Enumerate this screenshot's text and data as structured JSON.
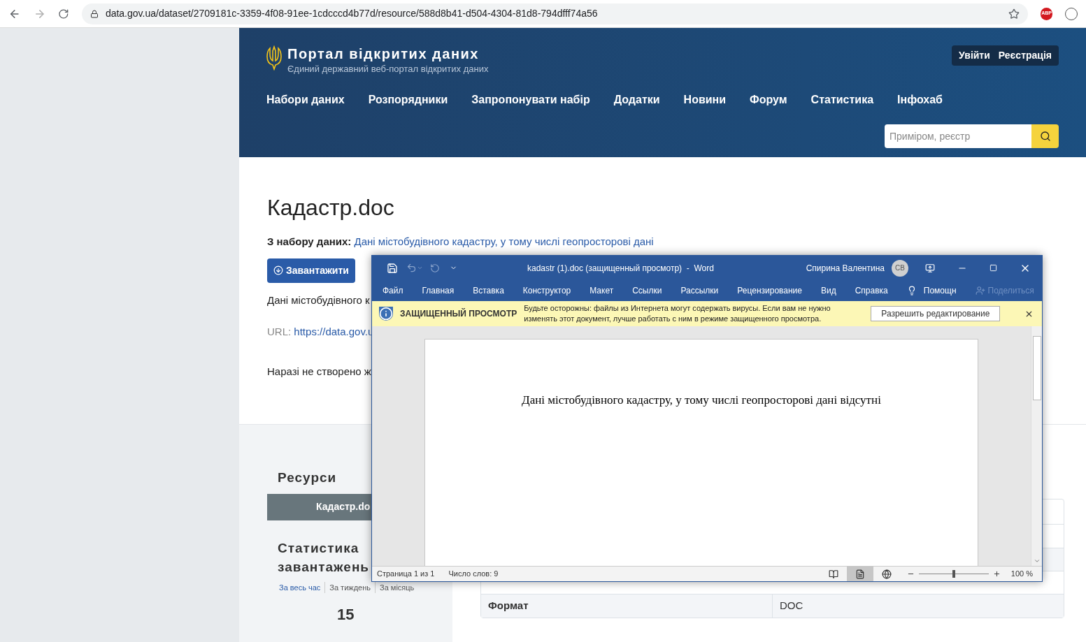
{
  "browser": {
    "url": "data.gov.ua/dataset/2709181c-3359-4f08-91ee-1cdcccd4b77d/resource/588d8b41-d504-4304-81d8-794dfff74a56",
    "extension_badge": "ABP"
  },
  "header": {
    "title": "Портал відкритих даних",
    "subtitle": "Єдиний державний веб-портал відкритих даних",
    "auth": [
      "Увійти",
      "Реєстрація"
    ],
    "nav": [
      "Набори даних",
      "Розпорядники",
      "Запропонувати набір",
      "Додатки",
      "Новини",
      "Форум",
      "Статистика",
      "Інфохаб"
    ],
    "search": {
      "placeholder": "Приміром, реєстр"
    }
  },
  "resource": {
    "title": "Кадастр.doc",
    "dataset_label": "З набору даних:",
    "dataset_link": "Дані містобудівного кадастру, у тому числі геопросторові дані",
    "download": "Завантажити",
    "description": "Дані містобудівного к",
    "url_label": "URL:",
    "url": "https://data.gov.u",
    "note": "Наразі не створено ж"
  },
  "sidebar": {
    "resources_title": "Ресурси",
    "resources": [
      {
        "label": "Кадастр.do",
        "selected": true
      }
    ],
    "stats_title": "Статистика завантажень",
    "stats_tabs": [
      {
        "label": "За весь час",
        "selected": true
      },
      {
        "label": "За тиждень",
        "selected": false
      },
      {
        "label": "За місяць",
        "selected": false
      }
    ],
    "count": "15"
  },
  "table": {
    "rows": [
      {
        "label": "Формат",
        "value": "DOC"
      }
    ]
  },
  "word": {
    "title": "kadastr (1).doc (защищенный просмотр)  -  Word",
    "user": "Спирина Валентина",
    "avatar": "СВ",
    "menu": [
      {
        "label": "Файл",
        "kind": "tab"
      },
      {
        "label": "Главная",
        "kind": "tab"
      },
      {
        "label": "Вставка",
        "kind": "tab"
      },
      {
        "label": "Конструктор",
        "kind": "tab"
      },
      {
        "label": "Макет",
        "kind": "tab"
      },
      {
        "label": "Ссылки",
        "kind": "tab"
      },
      {
        "label": "Рассылки",
        "kind": "tab"
      },
      {
        "label": "Рецензирование",
        "kind": "tab"
      },
      {
        "label": "Вид",
        "kind": "tab"
      },
      {
        "label": "Справка",
        "kind": "tab"
      },
      {
        "label": "Помощн",
        "kind": "help"
      },
      {
        "label": "Поделиться",
        "kind": "share",
        "disabled": true
      }
    ],
    "protected": {
      "title": "ЗАЩИЩЕННЫЙ ПРОСМОТР",
      "message": "Будьте осторожны: файлы из Интернета могут содержать вирусы. Если вам не нужно изменять этот документ, лучше работать с ним в режиме защищенного просмотра.",
      "button": "Разрешить редактирование"
    },
    "document_text": "Дані містобудівного кадастру, у тому числі геопросторові дані відсутні",
    "status": {
      "page": "Страница 1 из 1",
      "words": "Число слов: 9",
      "views": [
        {
          "kind": "read",
          "selected": false
        },
        {
          "kind": "print",
          "selected": true
        },
        {
          "kind": "web",
          "selected": false
        }
      ],
      "zoom_slider": {
        "level": 0.5
      },
      "zoom": "100 %"
    }
  }
}
